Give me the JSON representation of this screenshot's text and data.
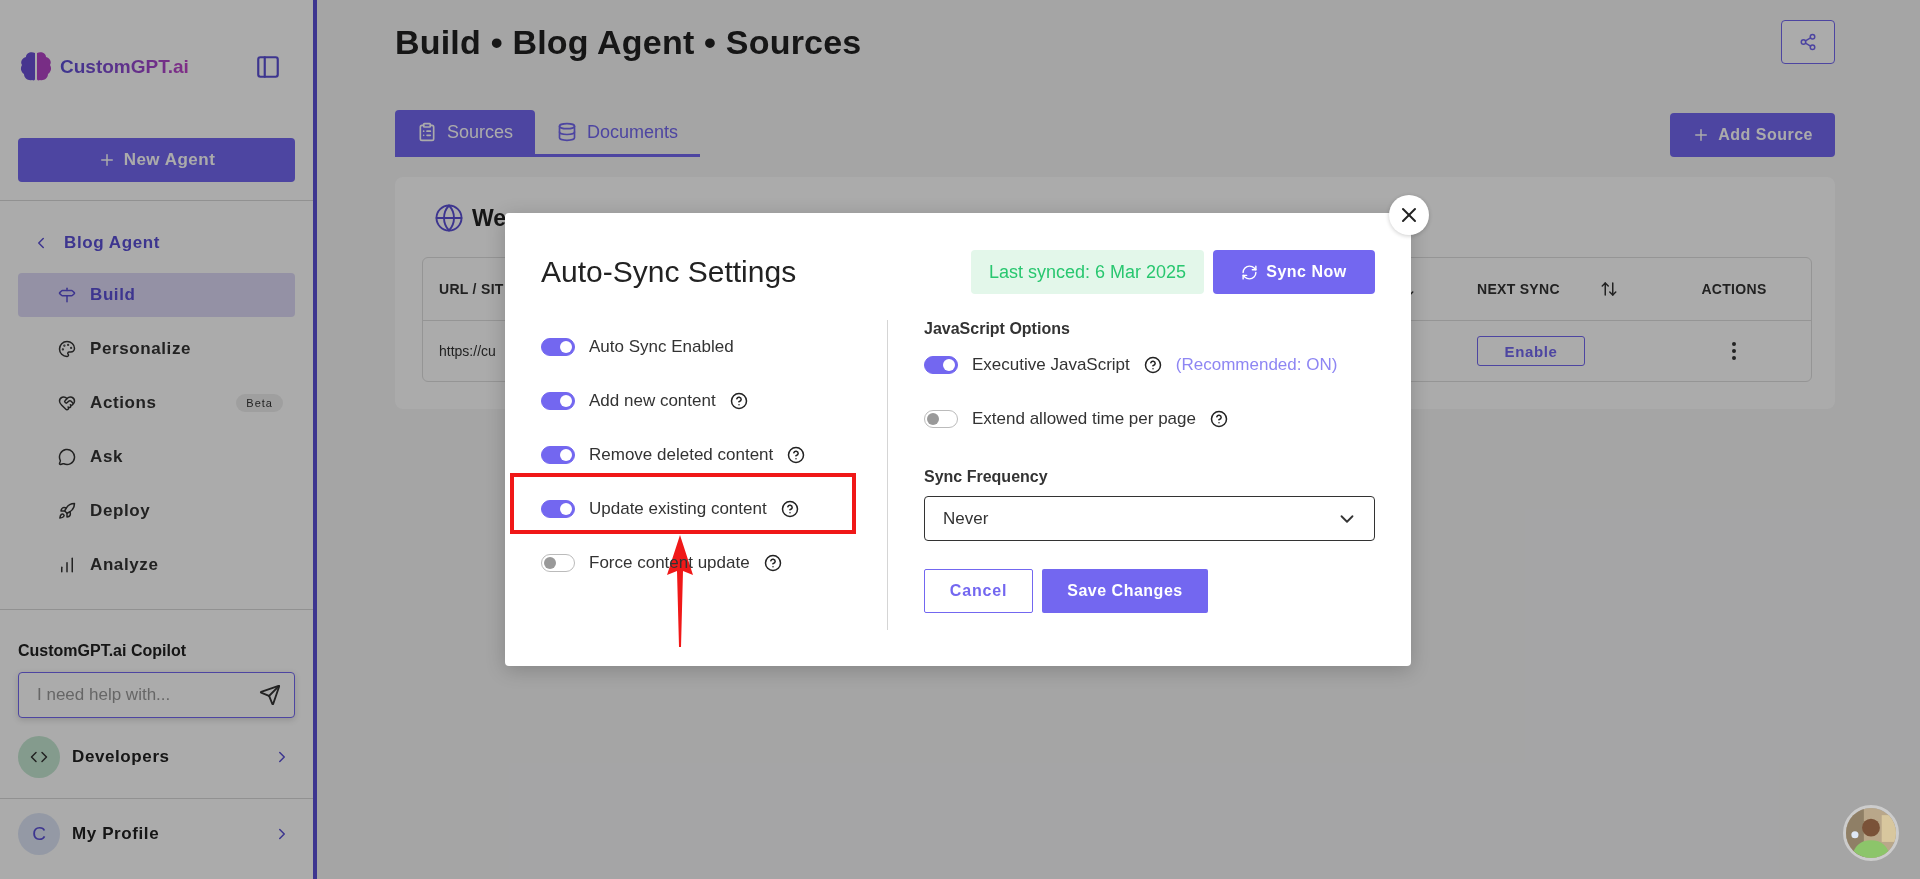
{
  "sidebar": {
    "logo": "CustomGPT.ai",
    "new_agent": "New Agent",
    "back": "Blog Agent",
    "items": [
      {
        "label": "Build",
        "selected": true
      },
      {
        "label": "Personalize",
        "selected": false
      },
      {
        "label": "Actions",
        "selected": false,
        "badge": "Beta"
      },
      {
        "label": "Ask",
        "selected": false
      },
      {
        "label": "Deploy",
        "selected": false
      },
      {
        "label": "Analyze",
        "selected": false
      }
    ],
    "copilot": {
      "title": "CustomGPT.ai Copilot",
      "placeholder": "I need help with..."
    },
    "developers": "Developers",
    "profile": {
      "initial": "C",
      "label": "My Profile"
    }
  },
  "header": {
    "title": "Build • Blog Agent • Sources"
  },
  "tabs": [
    {
      "label": "Sources",
      "selected": true
    },
    {
      "label": "Documents",
      "selected": false
    }
  ],
  "add_source": "Add Source",
  "card": {
    "title": "We",
    "columns": [
      {
        "label": "URL / SIT",
        "sortable": false
      },
      {
        "sortable": true
      },
      {
        "label": "NEXT SYNC",
        "sortable": true
      },
      {
        "label": "ACTIONS",
        "sortable": false
      }
    ],
    "rows": [
      {
        "url": "https://cu",
        "next_sync": "Enable"
      }
    ]
  },
  "modal": {
    "title": "Auto-Sync Settings",
    "last_synced": "Last synced: 6 Mar 2025",
    "sync_now": "Sync Now",
    "toggles": [
      {
        "label": "Auto Sync Enabled",
        "on": true,
        "help": false
      },
      {
        "label": "Add new content",
        "on": true,
        "help": true
      },
      {
        "label": "Remove deleted content",
        "on": true,
        "help": true
      },
      {
        "label": "Update existing content",
        "on": true,
        "help": true
      },
      {
        "label": "Force content update",
        "on": false,
        "help": true
      }
    ],
    "js_title": "JavaScript Options",
    "js_toggles": [
      {
        "label": "Executive JavaScript",
        "on": true,
        "help": true,
        "note": "(Recommended: ON)"
      },
      {
        "label": "Extend allowed time per page",
        "on": false,
        "help": true
      }
    ],
    "frequency_label": "Sync Frequency",
    "frequency": "Never",
    "cancel": "Cancel",
    "save": "Save Changes"
  }
}
